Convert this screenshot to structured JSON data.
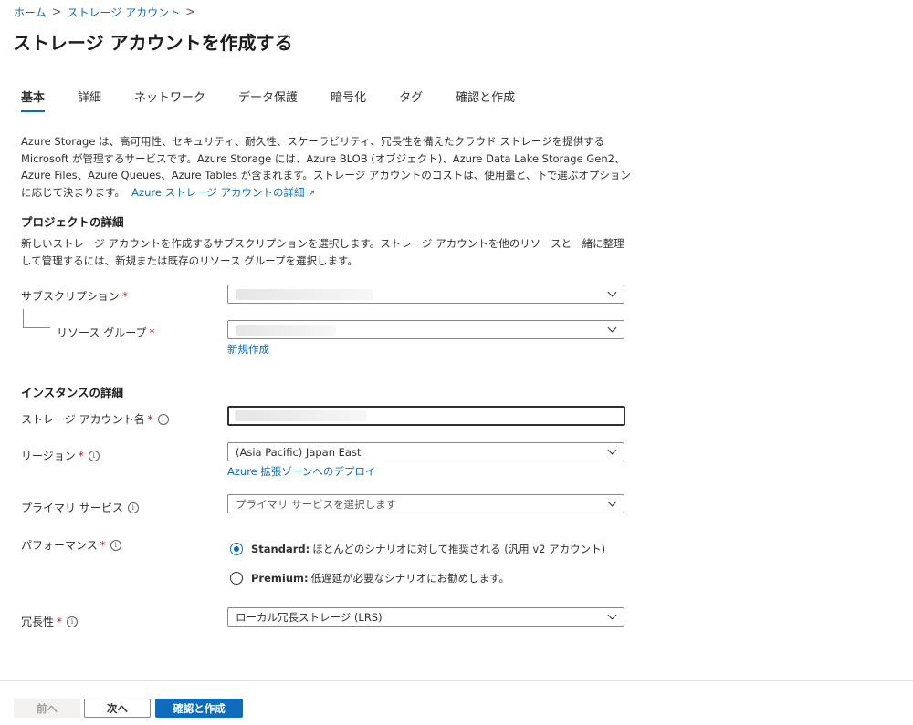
{
  "breadcrumb": {
    "home": "ホーム",
    "storage": "ストレージ アカウント",
    "sep": ">"
  },
  "header": {
    "title": "ストレージ アカウントを作成する",
    "more": "···"
  },
  "tabs": [
    {
      "label": "基本",
      "active": true
    },
    {
      "label": "詳細"
    },
    {
      "label": "ネットワーク"
    },
    {
      "label": "データ保護"
    },
    {
      "label": "暗号化"
    },
    {
      "label": "タグ"
    },
    {
      "label": "確認と作成"
    }
  ],
  "intro": {
    "text": "Azure Storage は、高可用性、セキュリティ、耐久性、スケーラビリティ、冗長性を備えたクラウド ストレージを提供する Microsoft が管理するサービスです。Azure Storage には、Azure BLOB (オブジェクト)、Azure Data Lake Storage Gen2、Azure Files、Azure Queues、Azure Tables が含まれます。ストレージ アカウントのコストは、使用量と、下で選ぶオプションに応じて決まります。",
    "link": "Azure ストレージ アカウントの詳細",
    "link_icon": "↗"
  },
  "project": {
    "heading": "プロジェクトの詳細",
    "description": "新しいストレージ アカウントを作成するサブスクリプションを選択します。ストレージ アカウントを他のリソースと一緒に整理して管理するには、新規または既存のリソース グループを選択します。",
    "subscription_label": "サブスクリプション",
    "resource_group_label": "リソース グループ",
    "create_new": "新規作成",
    "required_mark": "*"
  },
  "instance": {
    "heading": "インスタンスの詳細",
    "account_name_label": "ストレージ アカウント名",
    "region_label": "リージョン",
    "region_value": "(Asia Pacific) Japan East",
    "region_link": "Azure 拡張ゾーンへのデプロイ",
    "primary_service_label": "プライマリ サービス",
    "primary_service_placeholder": "プライマリ サービスを選択します",
    "performance_label": "パフォーマンス",
    "performance_options": [
      {
        "name": "Standard:",
        "desc": "ほとんどのシナリオに対して推奨される (汎用 v2 アカウント)",
        "checked": true
      },
      {
        "name": "Premium:",
        "desc": "低遅延が必要なシナリオにお勧めします。",
        "checked": false
      }
    ],
    "redundancy_label": "冗長性",
    "redundancy_value": "ローカル冗長ストレージ (LRS)",
    "required_mark": "*",
    "info_glyph": "i"
  },
  "footer": {
    "prev": "前へ",
    "next": "次へ",
    "review": "確認と作成"
  },
  "colors": {
    "accent": "#0f6cbd",
    "required": "#a4262c",
    "text": "#323130"
  }
}
